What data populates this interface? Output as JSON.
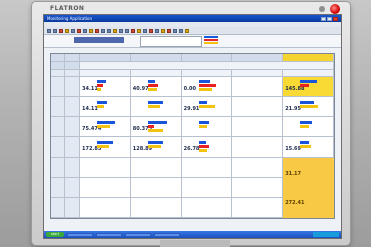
{
  "monitor": {
    "brand": "FLATRON"
  },
  "app": {
    "title": "Monitoring Application"
  },
  "grid": {
    "top_headers": [
      "",
      "",
      "",
      "",
      ""
    ],
    "selected_header_index": 4,
    "row_labels": [
      "",
      "",
      "",
      "",
      "",
      "",
      ""
    ],
    "rows": [
      {
        "values": [
          "34.11",
          "40.97",
          "0.00",
          "",
          "145.88"
        ]
      },
      {
        "values": [
          "14.11",
          "",
          "29.91",
          "",
          "21.95"
        ]
      },
      {
        "values": [
          "75.474",
          "80.373",
          "",
          "",
          ""
        ]
      },
      {
        "values": [
          "172.85",
          "128.89",
          "26.78",
          "",
          "15.69"
        ]
      },
      {
        "values": [
          "",
          "",
          "",
          "",
          "31.17"
        ]
      },
      {
        "values": [
          "",
          "",
          "",
          "",
          "272.41"
        ]
      }
    ]
  },
  "taskbar": {
    "start_label": "start"
  }
}
